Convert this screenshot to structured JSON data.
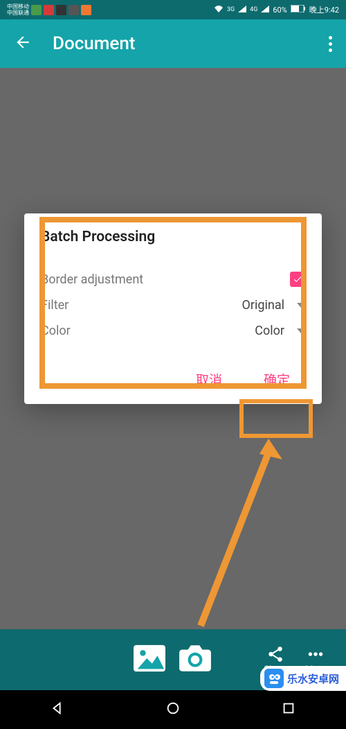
{
  "status": {
    "carrier1": "中国移动",
    "carrier2": "中国联通",
    "battery": "60%",
    "time": "晚上9:42"
  },
  "appbar": {
    "title": "Document"
  },
  "dialog": {
    "title": "Batch Processing",
    "border_label": "Border adjustment",
    "filter_label": "Filter",
    "filter_value": "Original",
    "color_label": "Color",
    "color_value": "Color",
    "cancel": "取消",
    "confirm": "确定"
  },
  "bottombar": {
    "share": "Share",
    "more": "More"
  },
  "watermark": {
    "text": "乐水安卓网"
  }
}
